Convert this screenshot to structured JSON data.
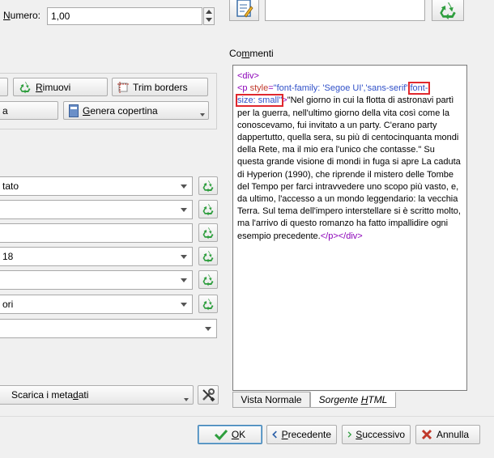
{
  "numero": {
    "label_prefix": "",
    "label_mnemonic": "N",
    "label_rest": "umero:",
    "value": "1,00"
  },
  "comments": {
    "label_prefix": "Co",
    "label_mnemonic": "m",
    "label_rest": "menti"
  },
  "cover_buttons": {
    "remove": {
      "mnemonic": "R",
      "rest": "imuovi"
    },
    "trim": {
      "label": "Trim borders"
    },
    "generate": {
      "mnemonic": "G",
      "rest": "enera copertina"
    },
    "partial_left": "a"
  },
  "fields": [
    {
      "value": "tato",
      "type": "combo"
    },
    {
      "value": "",
      "type": "combo"
    },
    {
      "value": "",
      "type": "text"
    },
    {
      "value": "18",
      "type": "combo"
    },
    {
      "value": "",
      "type": "combo"
    },
    {
      "value": "ori",
      "type": "combo"
    },
    {
      "value": "",
      "type": "combo"
    }
  ],
  "metadata_button": {
    "prefix": "Scarica i meta",
    "mnemonic": "d",
    "rest": "ati"
  },
  "editor": {
    "l1": "<div>",
    "l2_open": "<p",
    "l2_attr": "style",
    "l2_eq": "=",
    "l2_val1": "\"font-family: 'Segoe UI','sans-serif';",
    "l2_val2_hl": "font-",
    "l3_val_hl": "size: small\"",
    "l3_close": ">",
    "body_text": "\"Nel giorno in cui la flotta di astronavi partì per la guerra, nell'ultimo giorno della vita così come la conoscevamo, fui invitato a un party. C'erano party dappertutto, quella sera, su più di centocinquanta mondi della Rete, ma il mio era l'unico che contasse.\" Su questa grande visione di mondi in fuga si apre La caduta di Hyperion (1990), che riprende il mistero delle Tombe del Tempo per farci intravvedere uno scopo più vasto, e, da ultimo, l'accesso a un mondo leggendario: la vecchia Terra. Sul tema dell'impero interstellare si è scritto molto, ma l'arrivo di questo romanzo ha fatto impallidire ogni esempio precedente.",
    "end_tags": "</p></div>"
  },
  "tabs": {
    "normal": "Vista Normale",
    "source_prefix": "Sorgente ",
    "source_mnemonic": "H",
    "source_rest": "TML"
  },
  "footer": {
    "ok": {
      "mnemonic": "O",
      "rest": "K"
    },
    "prev": {
      "mnemonic": "P",
      "rest": "recedente"
    },
    "next": {
      "mnemonic": "S",
      "rest": "uccessivo"
    },
    "cancel": {
      "label": "Annulla"
    }
  },
  "colors": {
    "tag": "#8b00b8",
    "attr": "#c0392b",
    "value": "#3050c8",
    "highlight": "#e0282e",
    "recycle": "#2e9e3e"
  }
}
